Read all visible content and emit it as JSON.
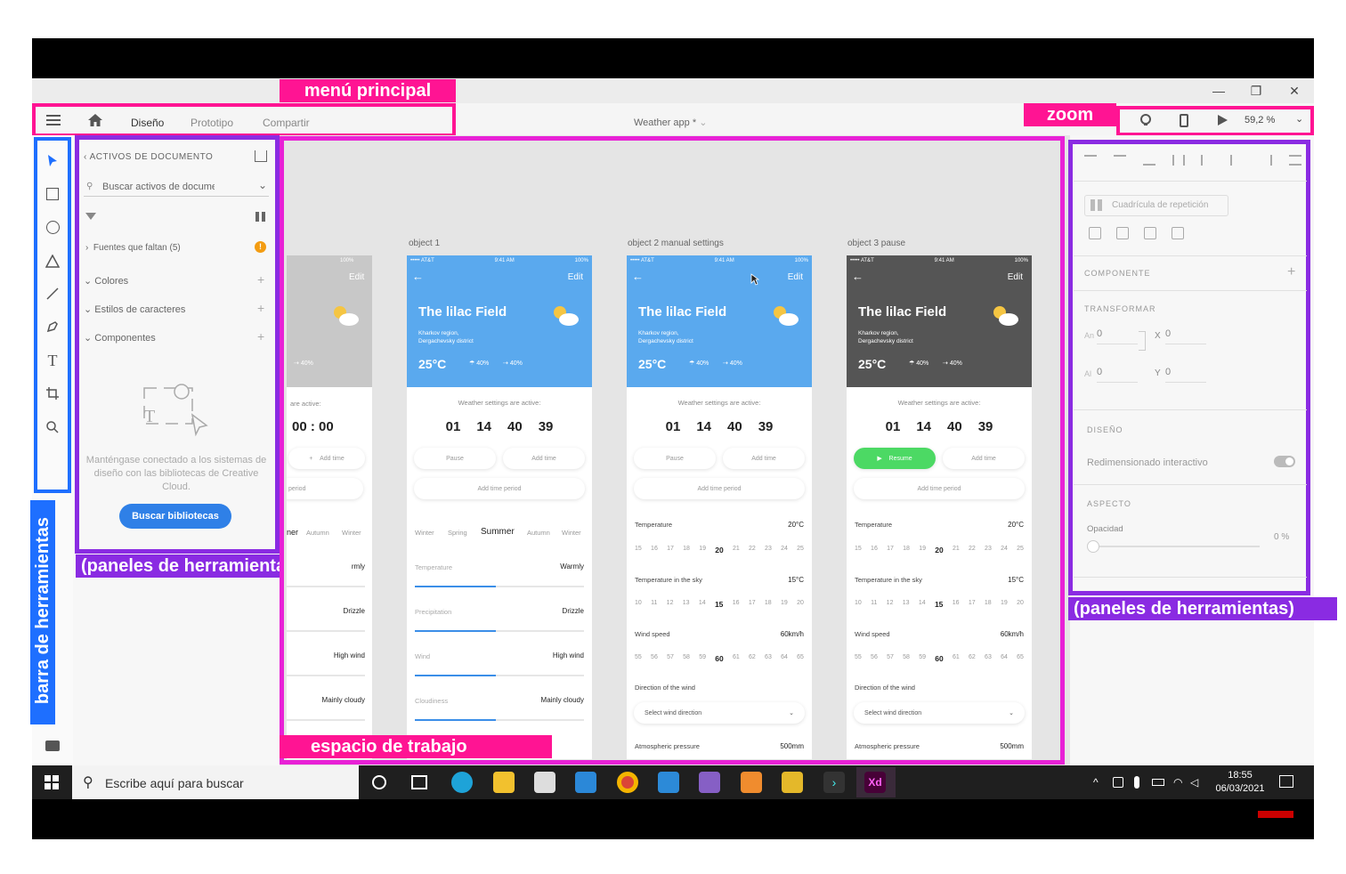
{
  "annotations": {
    "menu_principal": "menú principal",
    "zoom": "zoom",
    "barra_herramientas": "barra de herramientas",
    "paneles_left": "(paneles de herramientas)",
    "paneles_right": "(paneles de herramientas)",
    "espacio_trabajo": "espacio de trabajo"
  },
  "window": {
    "minimize": "—",
    "restore": "❐",
    "close": "✕"
  },
  "menu": {
    "tabs": [
      "Diseño",
      "Prototipo",
      "Compartir"
    ],
    "doc_title": "Weather app *",
    "zoom_value": "59,2 %"
  },
  "assets": {
    "header": "ACTIVOS DE DOCUMENTO",
    "search_placeholder": "Buscar activos de documento",
    "missing_fonts": "Fuentes que faltan (5)",
    "colors": "Colores",
    "char_styles": "Estilos de caracteres",
    "components": "Componentes",
    "cc_text": "Manténgase conectado a los sistemas de diseño con las bibliotecas de Creative Cloud.",
    "search_button": "Buscar bibliotecas"
  },
  "props": {
    "repeat_grid": "Cuadrícula de repetición",
    "component": "COMPONENTE",
    "transform": "TRANSFORMAR",
    "an_label": "An",
    "an_val": "0",
    "x_label": "X",
    "x_val": "0",
    "al_label": "Al",
    "al_val": "0",
    "y_label": "Y",
    "y_val": "0",
    "design": "DISEÑO",
    "resize": "Redimensionado interactivo",
    "aspect": "ASPECTO",
    "opacity": "Opacidad",
    "opacity_val": "0 %"
  },
  "artboards": {
    "labels": [
      "object 1",
      "object 2  manual settings",
      "object 3 pause"
    ],
    "status_carrier": "••••• AT&T",
    "status_time": "9:41 AM",
    "status_batt": "100%",
    "edit": "Edit",
    "title": "The lilac Field",
    "region1": "Kharkov region,",
    "region2": "Dergachevsky district",
    "temp": "25°C",
    "pct1": "40%",
    "pct2": "40%",
    "settings_active": "Weather settings are active:",
    "counter": [
      "01",
      "14",
      "40",
      "39"
    ],
    "pause": "Pause",
    "resume": "Resume",
    "add_time": "Add time",
    "add_period": "Add time period",
    "seasons": [
      "Winter",
      "Spring",
      "Summer",
      "Autumn",
      "Winter"
    ],
    "temperature": "Temperature",
    "warmly": "Warmly",
    "precipitation": "Precipitation",
    "drizzle": "Drizzle",
    "wind": "Wind",
    "high_wind": "High wind",
    "cloudiness": "Cloudiness",
    "mainly_cloudy": "Mainly cloudy",
    "temp_row": "Temperature",
    "temp_row_val": "20°C",
    "temp_ticks": [
      "15",
      "16",
      "17",
      "18",
      "19",
      "20",
      "21",
      "22",
      "23",
      "24",
      "25"
    ],
    "sky_row": "Temperature in the sky",
    "sky_val": "15°C",
    "sky_ticks": [
      "10",
      "11",
      "12",
      "13",
      "14",
      "15",
      "16",
      "17",
      "18",
      "19",
      "20"
    ],
    "wind_row": "Wind speed",
    "wind_val": "60km/h",
    "wind_ticks": [
      "55",
      "56",
      "57",
      "58",
      "59",
      "60",
      "61",
      "62",
      "63",
      "64",
      "65"
    ],
    "dir_row": "Direction of the wind",
    "dir_select": "Select wind direction",
    "atm_row": "Atmospheric pressure",
    "atm_val": "500mm",
    "partial_pct": "40%",
    "partial_active": "are active:",
    "partial_counter": [
      "00",
      "00"
    ],
    "partial_add": "Add time",
    "partial_period": "period",
    "partial_seasons": [
      "ner",
      "Autumn",
      "Winter"
    ],
    "partial_rows": [
      "rmly",
      "Drizzle",
      "High wind",
      "Mainly cloudy"
    ]
  },
  "taskbar": {
    "search": "Escribe aquí para buscar",
    "time": "18:55",
    "date": "06/03/2021"
  },
  "colors": {
    "pink": "#ff1493",
    "purple": "#8a2be2",
    "blue": "#1e6fff",
    "sky": "#5aa9ee",
    "dark": "#555555",
    "green": "#4cd964"
  }
}
